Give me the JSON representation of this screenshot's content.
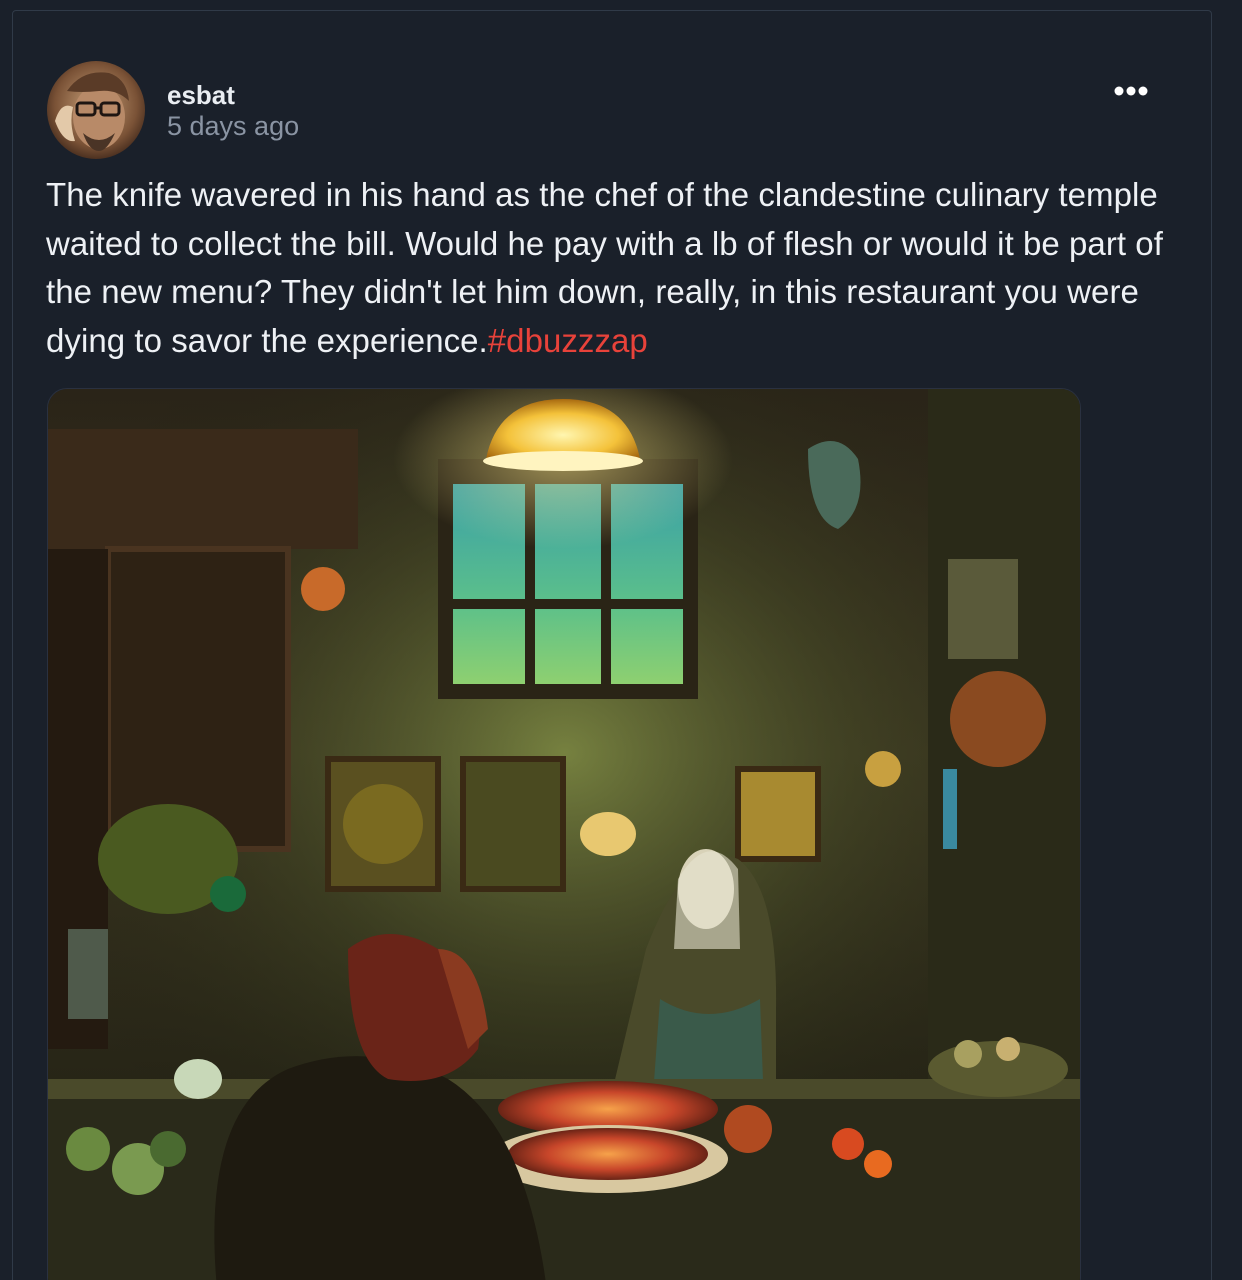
{
  "post": {
    "author": "esbat",
    "timestamp": "5 days ago",
    "body": "The knife wavered in his hand as the chef of the clandestine culinary temple waited to collect the bill. Would he pay with a lb of flesh or would it be part of the new menu? They didn't let him down, really, in this restaurant you were dying to savor the experience.",
    "hashtag": "#dbuzzzap",
    "more_icon": "more-dots-icon"
  },
  "colors": {
    "background": "#1a202a",
    "text": "#eef1f5",
    "muted": "#8a94a3",
    "hashtag": "#e8423a"
  }
}
